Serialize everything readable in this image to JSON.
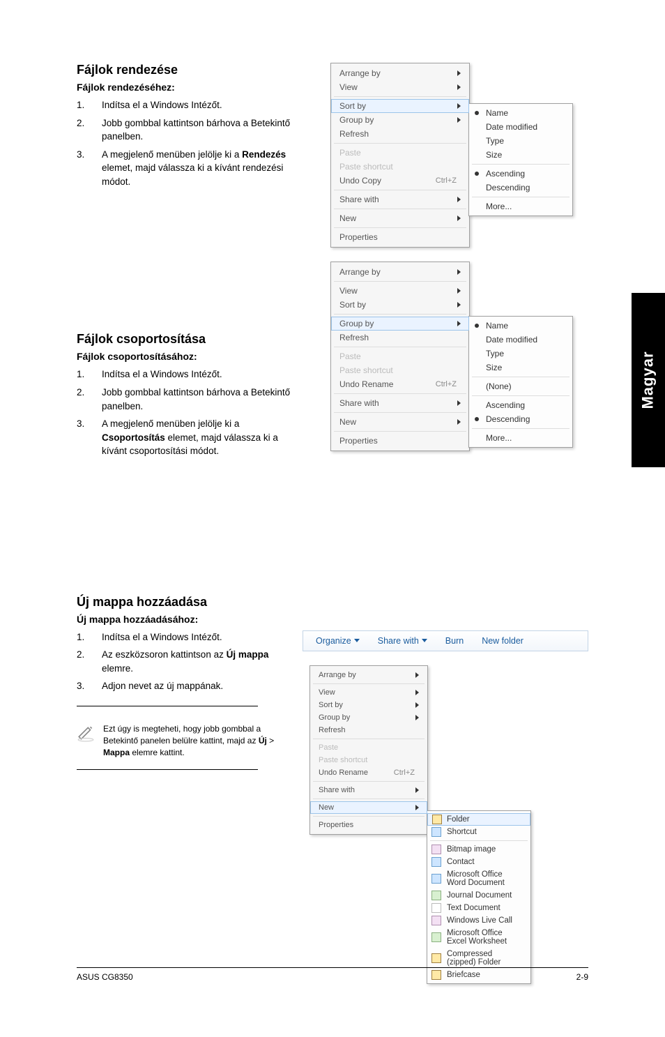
{
  "sidetab": "Magyar",
  "section1": {
    "title": "Fájlok rendezése",
    "subtitle": "Fájlok rendezéséhez:",
    "steps": [
      {
        "n": "1.",
        "t": "Indítsa el a Windows Intézőt."
      },
      {
        "n": "2.",
        "t": "Jobb gombbal kattintson bárhova a Betekintő panelben."
      },
      {
        "n": "3.",
        "t_pre": "A megjelenő menüben jelölje ki a ",
        "bold": "Rendezés",
        "t_post": " elemet, majd válassza ki a kívánt rendezési módot."
      }
    ]
  },
  "menu1": {
    "items": [
      {
        "l": "Arrange by",
        "arrow": true
      },
      {
        "l": "View",
        "arrow": true
      },
      {
        "sep": true
      },
      {
        "l": "Sort by",
        "arrow": true,
        "hl": true
      },
      {
        "l": "Group by",
        "arrow": true
      },
      {
        "l": "Refresh"
      },
      {
        "sep": true
      },
      {
        "l": "Paste",
        "dis": true
      },
      {
        "l": "Paste shortcut",
        "dis": true
      },
      {
        "l": "Undo Copy",
        "sc": "Ctrl+Z"
      },
      {
        "sep": true
      },
      {
        "l": "Share with",
        "arrow": true
      },
      {
        "sep": true
      },
      {
        "l": "New",
        "arrow": true
      },
      {
        "sep": true
      },
      {
        "l": "Properties"
      }
    ],
    "sub": [
      {
        "l": "Name",
        "dot": true
      },
      {
        "l": "Date modified"
      },
      {
        "l": "Type"
      },
      {
        "l": "Size"
      },
      {
        "sep": true
      },
      {
        "l": "Ascending",
        "dot": true
      },
      {
        "l": "Descending"
      },
      {
        "sep": true
      },
      {
        "l": "More..."
      }
    ]
  },
  "section2": {
    "title": "Fájlok csoportosítása",
    "subtitle": "Fájlok csoportosításához:",
    "steps": [
      {
        "n": "1.",
        "t": "Indítsa el a Windows Intézőt."
      },
      {
        "n": "2.",
        "t": "Jobb gombbal kattintson bárhova a Betekintő panelben."
      },
      {
        "n": "3.",
        "t_pre": "A megjelenő menüben jelölje ki a ",
        "bold": "Csoportosítás",
        "t_post": " elemet, majd válassza ki a kívánt csoportosítási módot."
      }
    ]
  },
  "menu2": {
    "items": [
      {
        "l": "Arrange by",
        "arrow": true
      },
      {
        "sep": true
      },
      {
        "l": "View",
        "arrow": true
      },
      {
        "l": "Sort by",
        "arrow": true
      },
      {
        "sep": true
      },
      {
        "l": "Group by",
        "arrow": true,
        "hl": true
      },
      {
        "l": "Refresh"
      },
      {
        "sep": true
      },
      {
        "l": "Paste",
        "dis": true
      },
      {
        "l": "Paste shortcut",
        "dis": true
      },
      {
        "l": "Undo Rename",
        "sc": "Ctrl+Z"
      },
      {
        "sep": true
      },
      {
        "l": "Share with",
        "arrow": true
      },
      {
        "sep": true
      },
      {
        "l": "New",
        "arrow": true
      },
      {
        "sep": true
      },
      {
        "l": "Properties"
      }
    ],
    "sub": [
      {
        "l": "Name",
        "dot": true
      },
      {
        "l": "Date modified"
      },
      {
        "l": "Type"
      },
      {
        "l": "Size"
      },
      {
        "sep": true
      },
      {
        "l": "(None)"
      },
      {
        "sep": true
      },
      {
        "l": "Ascending"
      },
      {
        "l": "Descending",
        "dot": true
      },
      {
        "sep": true
      },
      {
        "l": "More..."
      }
    ]
  },
  "section3": {
    "title": "Új mappa hozzáadása",
    "subtitle": "Új mappa hozzáadásához:",
    "steps": [
      {
        "n": "1.",
        "t": "Indítsa el a Windows Intézőt."
      },
      {
        "n": "2.",
        "t_pre": "Az eszközsoron kattintson az ",
        "bold": "Új mappa",
        "t_post": " elemre."
      },
      {
        "n": "3.",
        "t": "Adjon nevet az új mappának."
      }
    ],
    "note_pre": "Ezt úgy is megteheti, hogy jobb gombbal a Betekintő panelen belülre kattint, majd az ",
    "note_b1": "Új",
    "note_gt": " > ",
    "note_b2": "Mappa",
    "note_post": " elemre kattint."
  },
  "toolbar": {
    "organize": "Organize",
    "share": "Share with",
    "burn": "Burn",
    "newfolder": "New folder"
  },
  "menu3": {
    "items": [
      {
        "l": "Arrange by",
        "arrow": true
      },
      {
        "sep": true
      },
      {
        "l": "View",
        "arrow": true
      },
      {
        "l": "Sort by",
        "arrow": true
      },
      {
        "l": "Group by",
        "arrow": true
      },
      {
        "l": "Refresh"
      },
      {
        "sep": true
      },
      {
        "l": "Paste",
        "dis": true
      },
      {
        "l": "Paste shortcut",
        "dis": true
      },
      {
        "l": "Undo Rename",
        "sc": "Ctrl+Z"
      },
      {
        "sep": true
      },
      {
        "l": "Share with",
        "arrow": true
      },
      {
        "sep": true
      },
      {
        "l": "New",
        "arrow": true,
        "hl": true
      },
      {
        "sep": true
      },
      {
        "l": "Properties"
      }
    ],
    "sub": [
      {
        "l": "Folder",
        "hl": true,
        "ico": "y"
      },
      {
        "l": "Shortcut",
        "ico": "b"
      },
      {
        "sep": true
      },
      {
        "l": "Bitmap image",
        "ico": "p"
      },
      {
        "l": "Contact",
        "ico": "b"
      },
      {
        "l": "Microsoft Office Word Document",
        "ico": "b"
      },
      {
        "l": "Journal Document",
        "ico": "g"
      },
      {
        "l": "Text Document",
        "ico": "w"
      },
      {
        "l": "Windows Live Call",
        "ico": "p"
      },
      {
        "l": "Microsoft Office Excel Worksheet",
        "ico": "g"
      },
      {
        "l": "Compressed (zipped) Folder",
        "ico": "y"
      },
      {
        "l": "Briefcase",
        "ico": "y"
      }
    ]
  },
  "footer": {
    "left": "ASUS CG8350",
    "right": "2-9"
  }
}
